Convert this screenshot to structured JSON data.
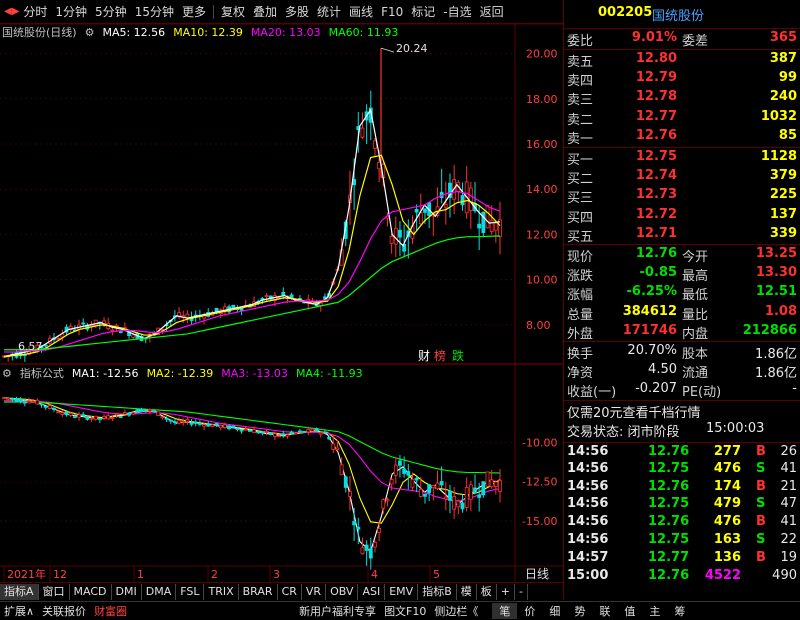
{
  "toolbar": {
    "periods": [
      "分时",
      "1分钟",
      "5分钟",
      "15分钟",
      "更多"
    ],
    "tools": [
      "复权",
      "叠加",
      "多股",
      "统计",
      "画线",
      "F10",
      "标记",
      "-自选",
      "返回"
    ]
  },
  "chart": {
    "title": "国统股份(日线)",
    "ma": [
      {
        "label": "MA5: 12.56",
        "color": "#ffffff"
      },
      {
        "label": "MA10: 12.39",
        "color": "#ffff00"
      },
      {
        "label": "MA20: 13.03",
        "color": "#ff00ff"
      },
      {
        "label": "MA60: 11.93",
        "color": "#00ff00"
      }
    ],
    "peak_label": "20.24",
    "low_label": "6.57",
    "yticks": [
      "20.00",
      "18.00",
      "16.00",
      "14.00",
      "12.00",
      "10.00",
      "8.00"
    ],
    "badges": [
      "财",
      "榜",
      "跌"
    ],
    "indicator_title": "指标公式",
    "indicator_ma": [
      {
        "label": "MA1: -12.56",
        "color": "#ffffff"
      },
      {
        "label": "MA2: -12.39",
        "color": "#ffff00"
      },
      {
        "label": "MA3: -13.03",
        "color": "#ff00ff"
      },
      {
        "label": "MA4: -11.93",
        "color": "#00ff00"
      }
    ],
    "ind_yticks": [
      "-10.00",
      "-12.50",
      "-15.00"
    ],
    "xlabels": [
      "2021年",
      "12",
      "1",
      "2",
      "3",
      "4",
      "5"
    ],
    "xaxis_right": "日线"
  },
  "chart_data": {
    "type": "line",
    "title": "",
    "ylim": [
      6,
      21
    ],
    "series": [
      {
        "name": "MA5",
        "values": [
          6.6,
          6.7,
          6.8,
          6.9,
          7.2,
          7.5,
          7.8,
          7.9,
          8.0,
          8.1,
          7.9,
          7.8,
          7.6,
          7.4,
          7.6,
          8.0,
          8.4,
          8.3,
          8.4,
          8.5,
          8.6,
          8.7,
          8.8,
          8.9,
          9.1,
          9.2,
          9.3,
          9.1,
          9.0,
          8.9,
          9.2,
          10.5,
          13.2,
          16.8,
          17.5,
          15.0,
          12.0,
          11.5,
          12.5,
          13.3,
          12.8,
          13.5,
          14.2,
          13.6,
          13.0,
          12.5,
          12.56
        ]
      },
      {
        "name": "MA10",
        "values": [
          6.6,
          6.65,
          6.7,
          6.8,
          7.0,
          7.3,
          7.6,
          7.8,
          7.9,
          8.0,
          7.95,
          7.85,
          7.7,
          7.55,
          7.55,
          7.8,
          8.1,
          8.25,
          8.35,
          8.45,
          8.55,
          8.65,
          8.75,
          8.85,
          9.0,
          9.1,
          9.2,
          9.15,
          9.05,
          9.0,
          9.05,
          9.7,
          11.3,
          13.7,
          15.4,
          15.5,
          14.2,
          12.6,
          12.0,
          12.6,
          13.0,
          13.1,
          13.4,
          13.5,
          13.3,
          12.9,
          12.39
        ]
      },
      {
        "name": "MA20",
        "values": [
          6.8,
          6.8,
          6.85,
          6.85,
          6.9,
          7.0,
          7.15,
          7.3,
          7.45,
          7.6,
          7.7,
          7.75,
          7.75,
          7.7,
          7.65,
          7.7,
          7.8,
          7.95,
          8.1,
          8.25,
          8.4,
          8.5,
          8.6,
          8.7,
          8.8,
          8.9,
          9.0,
          9.05,
          9.05,
          9.05,
          9.1,
          9.35,
          9.9,
          10.8,
          11.8,
          12.6,
          13.0,
          13.1,
          13.2,
          13.3,
          13.6,
          13.8,
          13.9,
          13.8,
          13.5,
          13.2,
          13.03
        ]
      },
      {
        "name": "MA60",
        "values": [
          6.9,
          6.9,
          6.9,
          6.9,
          6.95,
          7.0,
          7.05,
          7.1,
          7.15,
          7.2,
          7.25,
          7.3,
          7.35,
          7.4,
          7.45,
          7.5,
          7.55,
          7.6,
          7.7,
          7.8,
          7.9,
          8.0,
          8.1,
          8.2,
          8.3,
          8.4,
          8.5,
          8.6,
          8.7,
          8.8,
          8.9,
          9.0,
          9.3,
          9.7,
          10.1,
          10.5,
          10.8,
          11.0,
          11.2,
          11.4,
          11.6,
          11.75,
          11.85,
          11.9,
          11.9,
          11.92,
          11.93
        ]
      }
    ]
  },
  "panel": {
    "code": "002205",
    "name": "国统股份",
    "webi": {
      "label1": "委比",
      "val1": "9.01%",
      "label2": "委差",
      "val2": "365"
    },
    "sell": [
      {
        "label": "卖五",
        "price": "12.80",
        "vol": "387"
      },
      {
        "label": "卖四",
        "price": "12.79",
        "vol": "99"
      },
      {
        "label": "卖三",
        "price": "12.78",
        "vol": "240"
      },
      {
        "label": "卖二",
        "price": "12.77",
        "vol": "1032"
      },
      {
        "label": "卖一",
        "price": "12.76",
        "vol": "85"
      }
    ],
    "buy": [
      {
        "label": "买一",
        "price": "12.75",
        "vol": "1128"
      },
      {
        "label": "买二",
        "price": "12.74",
        "vol": "379"
      },
      {
        "label": "买三",
        "price": "12.73",
        "vol": "225"
      },
      {
        "label": "买四",
        "price": "12.72",
        "vol": "137"
      },
      {
        "label": "买五",
        "price": "12.71",
        "vol": "339"
      }
    ],
    "quote": [
      {
        "l1": "现价",
        "v1": "12.76",
        "c1": "green",
        "l2": "今开",
        "v2": "13.25",
        "c2": "red"
      },
      {
        "l1": "涨跌",
        "v1": "-0.85",
        "c1": "green",
        "l2": "最高",
        "v2": "13.30",
        "c2": "red"
      },
      {
        "l1": "涨幅",
        "v1": "-6.25%",
        "c1": "green",
        "l2": "最低",
        "v2": "12.51",
        "c2": "green"
      },
      {
        "l1": "总量",
        "v1": "384612",
        "c1": "yellow",
        "l2": "量比",
        "v2": "1.08",
        "c2": "red"
      },
      {
        "l1": "外盘",
        "v1": "171746",
        "c1": "red",
        "l2": "内盘",
        "v2": "212866",
        "c2": "green"
      }
    ],
    "fund": [
      {
        "l1": "换手",
        "v1": "20.70%",
        "l2": "股本",
        "v2": "1.86亿"
      },
      {
        "l1": "净资",
        "v1": "4.50",
        "l2": "流通",
        "v2": "1.86亿"
      },
      {
        "l1": "收益(一)",
        "v1": "-0.207",
        "l2": "PE(动)",
        "v2": "-"
      }
    ],
    "promo": "仅需20元查看千档行情",
    "status_label": "交易状态: 闭市阶段",
    "status_time": "15:00:03",
    "ticks": [
      {
        "t": "14:56",
        "p": "12.76",
        "v": "277",
        "bs": "B",
        "n": "26"
      },
      {
        "t": "14:56",
        "p": "12.75",
        "v": "476",
        "bs": "S",
        "n": "41"
      },
      {
        "t": "14:56",
        "p": "12.76",
        "v": "174",
        "bs": "B",
        "n": "21"
      },
      {
        "t": "14:56",
        "p": "12.75",
        "v": "479",
        "bs": "S",
        "n": "47"
      },
      {
        "t": "14:56",
        "p": "12.76",
        "v": "476",
        "bs": "B",
        "n": "41"
      },
      {
        "t": "14:56",
        "p": "12.75",
        "v": "163",
        "bs": "S",
        "n": "22"
      },
      {
        "t": "14:57",
        "p": "12.77",
        "v": "136",
        "bs": "B",
        "n": "19"
      },
      {
        "t": "15:00",
        "p": "12.76",
        "v": "4522",
        "bs": "",
        "n": "490"
      }
    ]
  },
  "indbar": [
    "指标A",
    "窗口",
    "MACD",
    "DMI",
    "DMA",
    "FSL",
    "TRIX",
    "BRAR",
    "CR",
    "VR",
    "OBV",
    "ASI",
    "EMV",
    "指标B",
    "模",
    "板",
    "+",
    "-"
  ],
  "bottombar": [
    "扩展∧",
    "关联报价",
    "财富圈",
    "新用户福利专享",
    "图文F10",
    "侧边栏《",
    "笔",
    "价",
    "细",
    "势",
    "联",
    "值",
    "主",
    "筹"
  ]
}
